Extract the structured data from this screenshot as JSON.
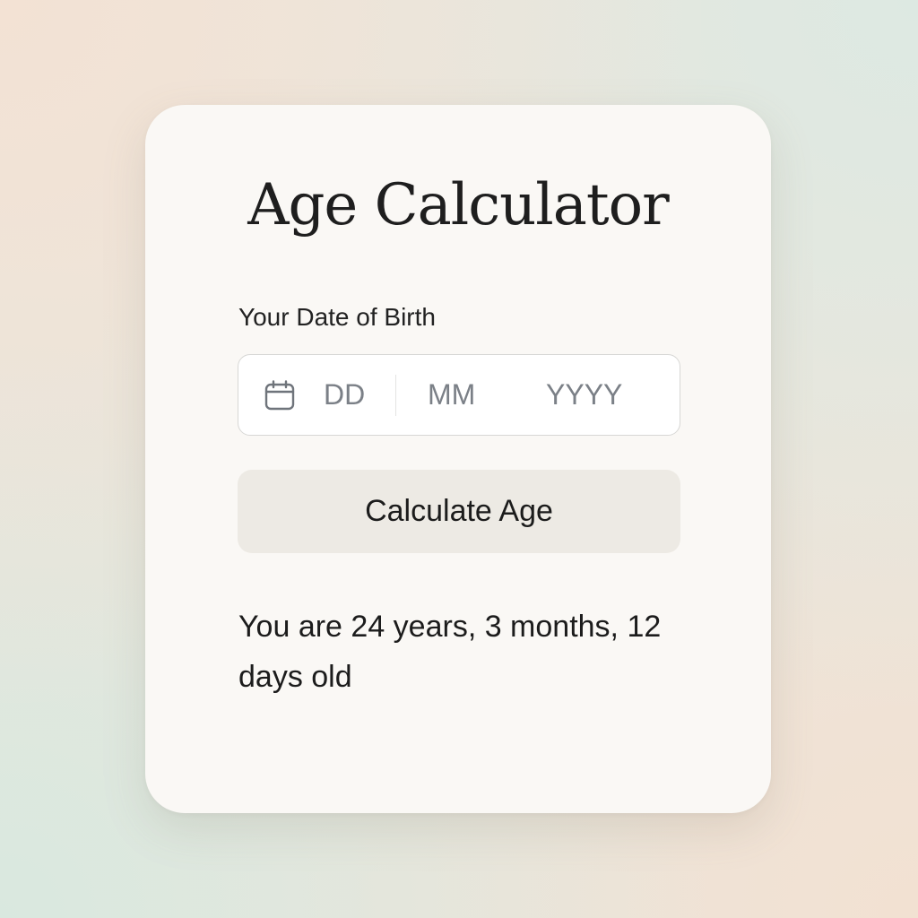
{
  "card": {
    "title": "Age Calculator",
    "date_of_birth": {
      "label": "Your Date of Birth",
      "icon": "calendar-icon",
      "day_placeholder": "DD",
      "month_placeholder": "MM",
      "year_placeholder": "YYYY"
    },
    "calculate_button": {
      "label": "Calculate Age"
    },
    "result": {
      "text": "You are 24 years, 3 months, 12 days old"
    }
  },
  "colors": {
    "card_background": "#faf8f5",
    "button_background": "#edeae4",
    "placeholder_text": "#7b8087",
    "primary_text": "#1c1c1c"
  }
}
